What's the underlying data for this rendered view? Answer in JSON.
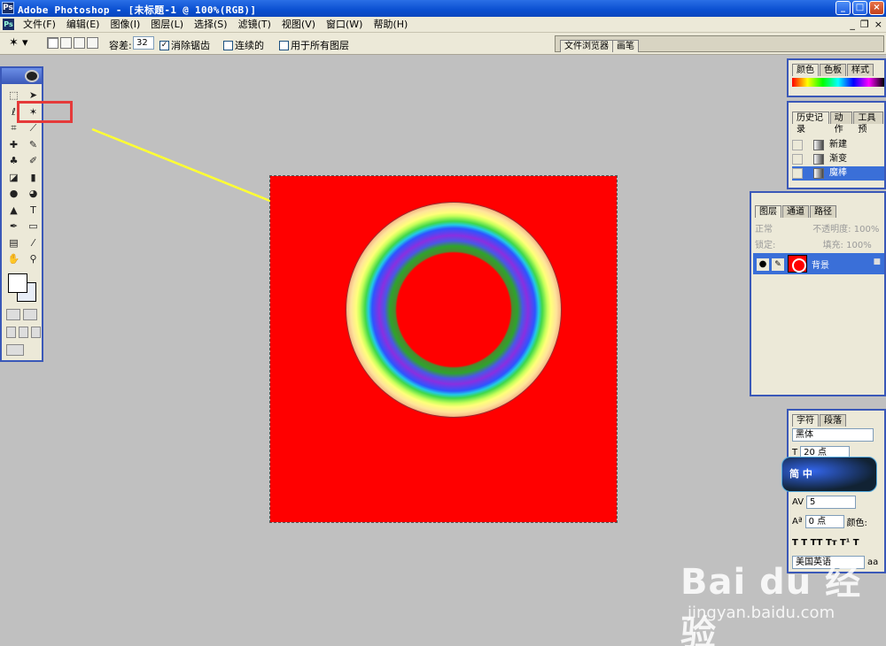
{
  "window": {
    "title": "Adobe Photoshop - [未标题-1 @ 100%(RGB)]",
    "min_label": "_",
    "max_label": "□",
    "close_label": "×"
  },
  "menubar": {
    "items": [
      "文件(F)",
      "编辑(E)",
      "图像(I)",
      "图层(L)",
      "选择(S)",
      "滤镜(T)",
      "视图(V)",
      "窗口(W)",
      "帮助(H)"
    ],
    "mdi_min": "_",
    "mdi_restore": "❐",
    "mdi_close": "×"
  },
  "options": {
    "tolerance_label": "容差:",
    "tolerance_value": "32",
    "anti_alias_label": "消除锯齿",
    "anti_alias_checked": "✓",
    "contiguous_label": "连续的",
    "all_layers_label": "用于所有图层",
    "well_tabs": [
      "文件浏览器",
      "画笔"
    ]
  },
  "colors": {
    "canvas": "#ff0000",
    "titlebar": "#0a4fd0",
    "highlight": "#e53a3a",
    "arrow": "#ffff33"
  },
  "palettes": {
    "color": {
      "tabs": [
        "颜色",
        "色板",
        "样式"
      ]
    },
    "history": {
      "tabs": [
        "历史记录",
        "动作",
        "工具预"
      ],
      "items": [
        "新建",
        "渐变",
        "魔棒"
      ]
    },
    "layers": {
      "tabs": [
        "图层",
        "通道",
        "路径"
      ],
      "blend_mode": "正常",
      "opacity_label": "不透明度:",
      "opacity_value": "100%",
      "lock_label": "锁定:",
      "fill_label": "填充:",
      "fill_value": "100%",
      "layer_name": "背景"
    },
    "character": {
      "tabs": [
        "字符",
        "段落"
      ],
      "font": "黑体",
      "size": "20 点",
      "tracking": "5",
      "baseline": "0 点",
      "color_label": "颜色:",
      "style_buttons": "T  T   TT Tт T¹ T",
      "language": "美国英语",
      "aa_label": "aa"
    }
  },
  "watermark": {
    "sticker_text": "简 中",
    "logo_text": "Bai du 经验",
    "url": "jingyan.baidu.com"
  }
}
